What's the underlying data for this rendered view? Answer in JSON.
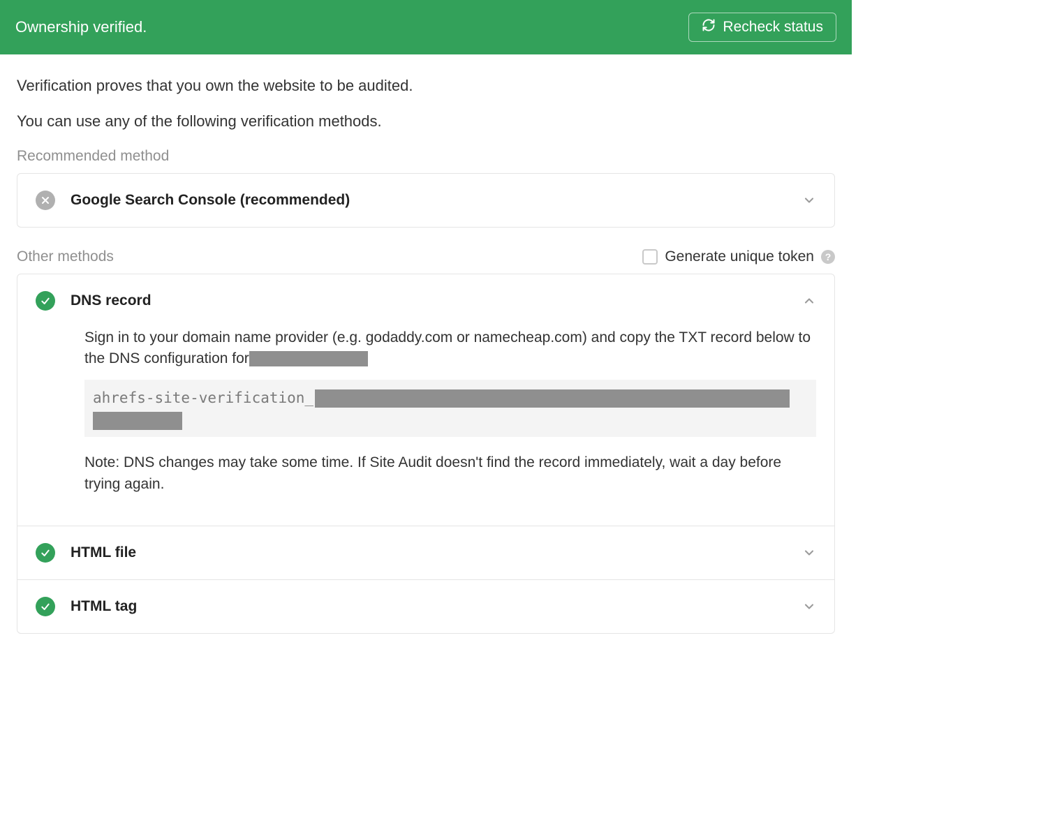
{
  "banner": {
    "message": "Ownership verified.",
    "recheck_label": "Recheck status"
  },
  "intro": {
    "line1": "Verification proves that you own the website to be audited.",
    "line2": "You can use any of the following verification methods."
  },
  "sections": {
    "recommended_label": "Recommended method",
    "other_label": "Other methods",
    "generate_token_label": "Generate unique token"
  },
  "methods": {
    "gsc": {
      "title": "Google Search Console (recommended)",
      "status": "unverified",
      "expanded": false
    },
    "dns": {
      "title": "DNS record",
      "status": "verified",
      "expanded": true,
      "instruction": "Sign in to your domain name provider (e.g. godaddy.com or namecheap.com) and copy the TXT record below to the DNS configuration for",
      "code_prefix": "ahrefs-site-verification_",
      "note": "Note: DNS changes may take some time. If Site Audit doesn't find the record immediately, wait a day before trying again."
    },
    "html_file": {
      "title": "HTML file",
      "status": "verified",
      "expanded": false
    },
    "html_tag": {
      "title": "HTML tag",
      "status": "verified",
      "expanded": false
    }
  },
  "colors": {
    "brand_green": "#33a15a",
    "muted_grey": "#8f8f8f"
  }
}
